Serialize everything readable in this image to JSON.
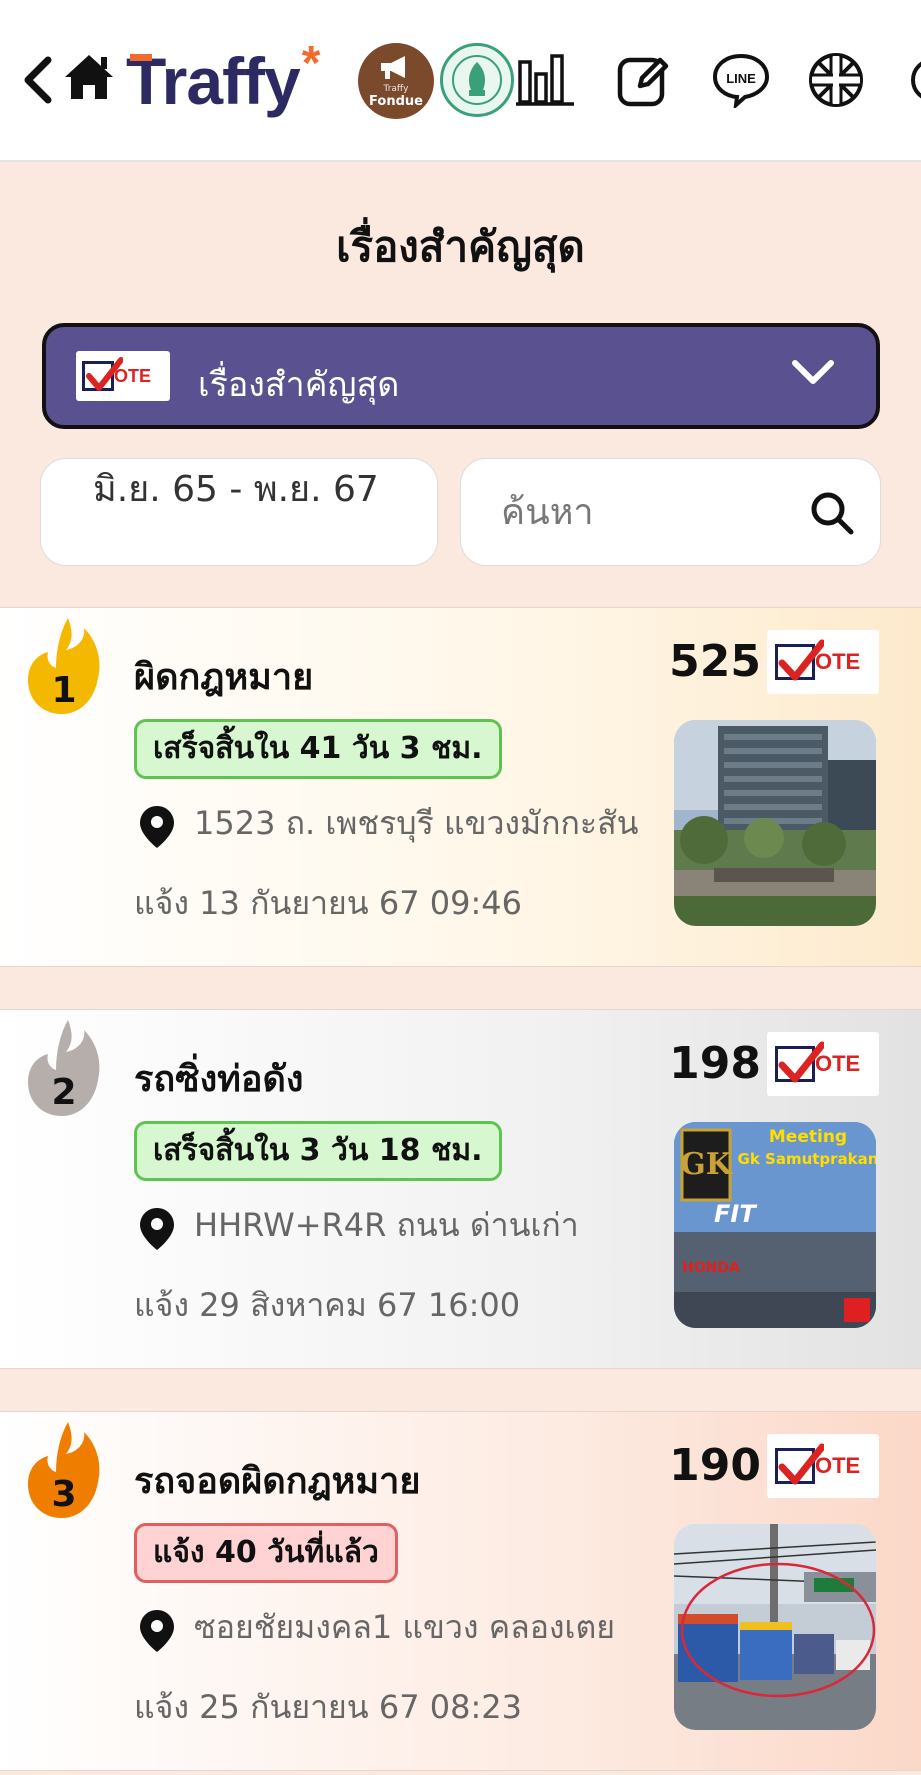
{
  "header": {
    "logo_text": "Traffy",
    "logo_star": "*",
    "fondue_small": "Traffy",
    "fondue_label": "Fondue",
    "icons": [
      "back-arrow-icon",
      "home-icon",
      "megaphone-icon",
      "city-seal-icon",
      "bar-chart-icon",
      "edit-icon",
      "line-icon",
      "uk-flag-icon"
    ]
  },
  "page": {
    "title": "เรื่องสำคัญสุด"
  },
  "filter": {
    "dropdown_label": "เรื่องสำคัญสุด",
    "vote_badge": "OTE",
    "date_range": "มิ.ย. 65 - พ.ย. 67",
    "search_placeholder": "ค้นหา"
  },
  "colors": {
    "accent_purple": "#5a5190",
    "gold": "#f5b800",
    "silver": "#b5aeab",
    "bronze": "#ef7d00",
    "status_green": "#5ec450",
    "status_red": "#e06060"
  },
  "issues": [
    {
      "rank": "1",
      "category": "ผิดกฎหมาย",
      "votes": "525",
      "status": "เสร็จสิ้นใน 41 วัน 3 ชม.",
      "status_type": "done",
      "address": "1523 ถ. เพชรบุรี แขวงมักกะสัน",
      "reported": "แจ้ง 13 กันยายน 67 09:46",
      "thumbnail": "building-photo"
    },
    {
      "rank": "2",
      "category": "รถซิ่งท่อดัง",
      "votes": "198",
      "status": "เสร็จสิ้นใน 3 วัน 18 ชม.",
      "status_type": "done",
      "address": "HHRW+R4R ถนน ด่านเก่า",
      "reported": "แจ้ง 29 สิงหาคม 67 16:00",
      "thumbnail": "meeting-poster",
      "thumb_title_1": "Meeting",
      "thumb_title_2": "Gk Samutprakan",
      "thumb_brand": "HONDA",
      "thumb_fit": "FIT"
    },
    {
      "rank": "3",
      "category": "รถจอดผิดกฎหมาย",
      "votes": "190",
      "status": "แจ้ง 40 วันที่แล้ว",
      "status_type": "open",
      "address": "ซอยชัยมงคล1 แขวง คลองเตย",
      "reported": "แจ้ง 25 กันยายน 67 08:23",
      "thumbnail": "street-photo"
    }
  ]
}
